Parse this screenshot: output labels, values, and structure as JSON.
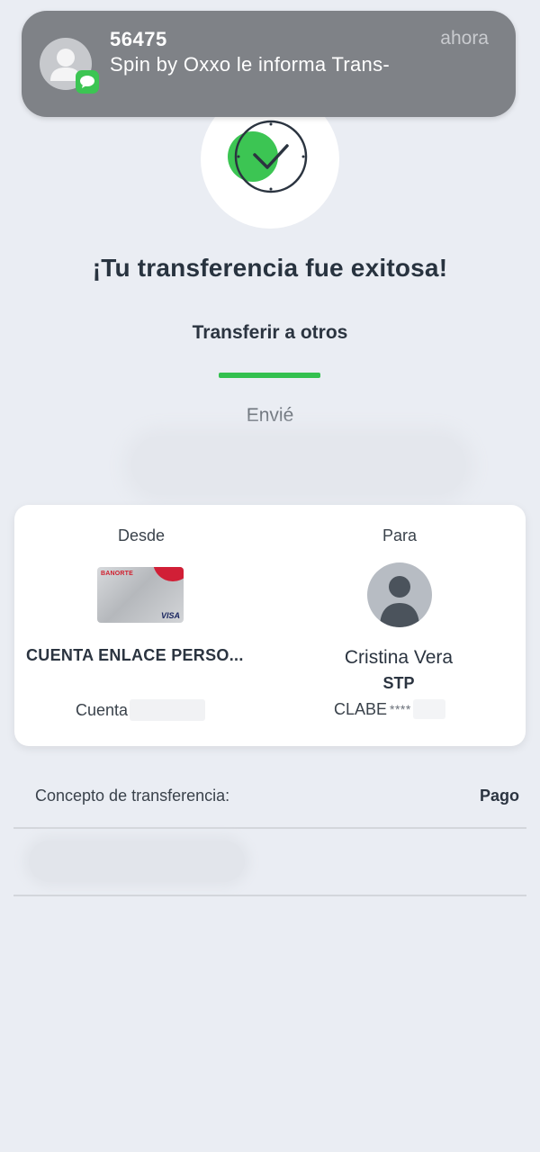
{
  "notification": {
    "sender": "56475",
    "time": "ahora",
    "body": "Spin by Oxxo le informa Trans-",
    "app_icon": "messages-icon",
    "avatar_icon": "person-icon"
  },
  "status": {
    "icon": "check-circle-icon",
    "title": "¡Tu transferencia fue exitosa!",
    "subtitle": "Transferir a otros",
    "sent_label": "Envié",
    "accent_color": "#33c04f"
  },
  "transfer_card": {
    "from": {
      "label": "Desde",
      "card_brand": "BANORTE",
      "card_network": "VISA",
      "account_name": "CUENTA ENLACE PERSO...",
      "account_label": "Cuenta"
    },
    "to": {
      "label": "Para",
      "name": "Cristina Vera",
      "bank": "STP",
      "clabe_label": "CLABE",
      "clabe_masked": "****"
    }
  },
  "concept": {
    "label": "Concepto de transferencia:",
    "value": "Pago"
  }
}
